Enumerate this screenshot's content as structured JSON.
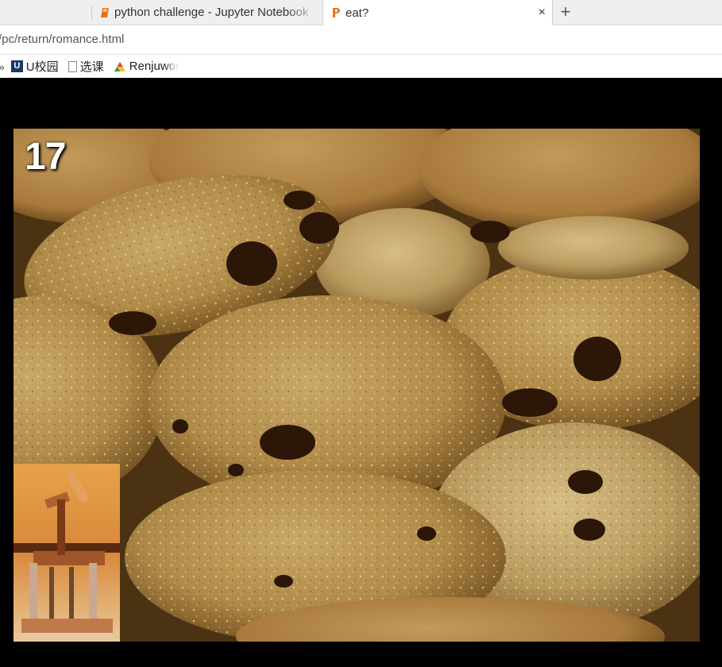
{
  "tabs": [
    {
      "title": "python challenge - Jupyter Notebook",
      "icon": "notebook-icon",
      "active": false
    },
    {
      "title": "eat?",
      "icon": "python-challenge-icon",
      "active": true,
      "close": "×"
    }
  ],
  "new_tab_label": "+",
  "address": {
    "url": "/pc/return/romance.html"
  },
  "bookmarks": {
    "separator": "»",
    "items": [
      {
        "label": "U校园",
        "icon": "u-campus-icon"
      },
      {
        "label": "选课",
        "icon": "page-icon"
      },
      {
        "label": "Renjuworld",
        "icon": "renju-icon"
      }
    ]
  },
  "page": {
    "image_number": "17",
    "main_image": "cookies-photo",
    "inset_image": "wooden-press-photo"
  },
  "colors": {
    "page_background": "#000000",
    "tab_strip": "#efefef",
    "tab_icon_orange": "#e8731a"
  }
}
